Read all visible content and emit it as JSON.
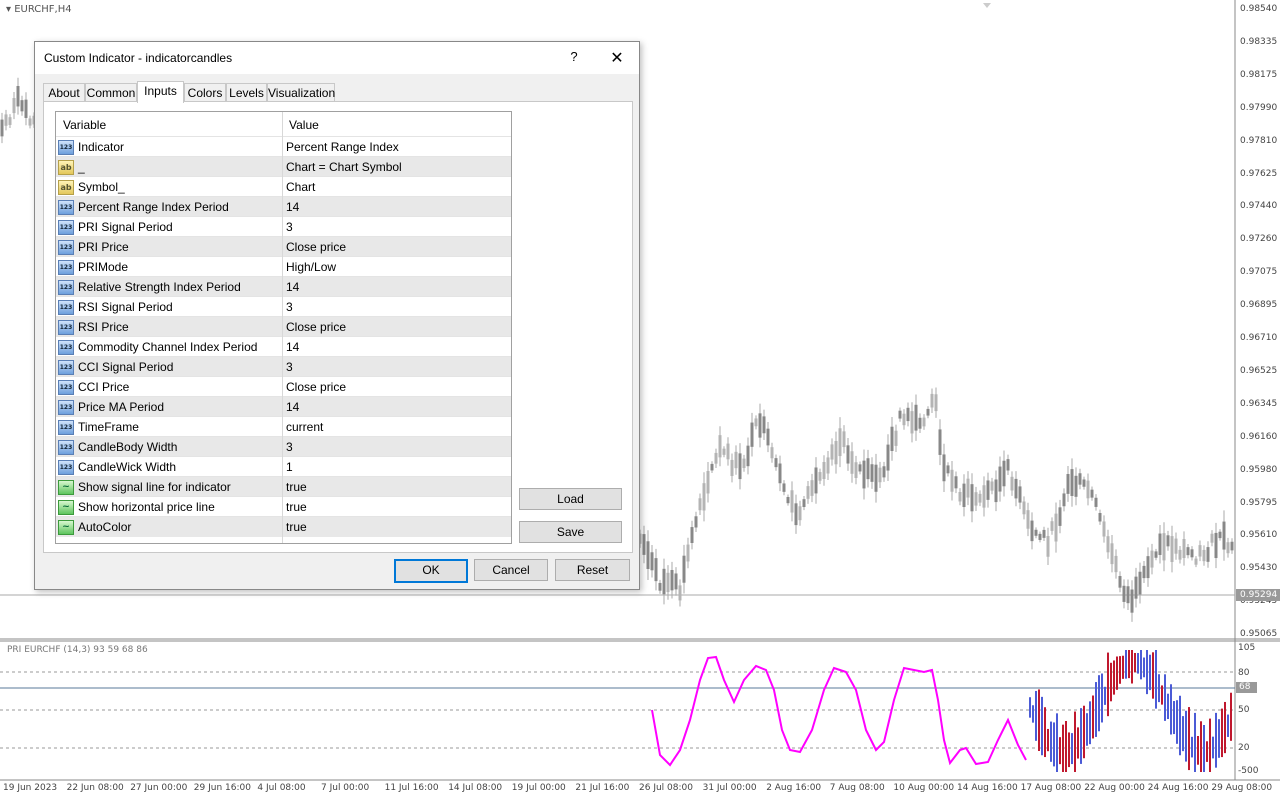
{
  "chart": {
    "symbol_label": "EURCHF,H4",
    "current_price": "0.95294",
    "price_axis": [
      "0.98540",
      "0.98335",
      "0.98175",
      "0.97990",
      "0.97810",
      "0.97625",
      "0.97440",
      "0.97260",
      "0.97075",
      "0.96895",
      "0.96710",
      "0.96525",
      "0.96345",
      "0.96160",
      "0.95980",
      "0.95795",
      "0.95610",
      "0.95430",
      "0.95245",
      "0.95065"
    ],
    "time_axis": [
      "19 Jun 2023",
      "22 Jun 08:00",
      "27 Jun 00:00",
      "29 Jun 16:00",
      "4 Jul 08:00",
      "7 Jul 00:00",
      "11 Jul 16:00",
      "14 Jul 08:00",
      "19 Jul 00:00",
      "21 Jul 16:00",
      "26 Jul 08:00",
      "31 Jul 00:00",
      "2 Aug 16:00",
      "7 Aug 08:00",
      "10 Aug 00:00",
      "14 Aug 16:00",
      "17 Aug 08:00",
      "22 Aug 00:00",
      "24 Aug 16:00",
      "29 Aug 08:00"
    ],
    "candle_color": "#b4b4b4"
  },
  "indicator": {
    "title": "PRI EURCHF (14,3) 93 59 68 86",
    "axis": [
      "105",
      "80",
      "50",
      "20",
      "-500"
    ],
    "current_value": "68",
    "line_color": "#ff00ff",
    "up_color": "#4b5bd6",
    "down_color": "#c0182e"
  },
  "dialog": {
    "title": "Custom Indicator - indicatorcandles",
    "help": "?",
    "close": "✕",
    "tabs": [
      "About",
      "Common",
      "Inputs",
      "Colors",
      "Levels",
      "Visualization"
    ],
    "active_tab": "Inputs",
    "columns": {
      "variable": "Variable",
      "value": "Value"
    },
    "rows": [
      {
        "icon": "123",
        "variable": "Indicator",
        "value": "Percent Range Index"
      },
      {
        "icon": "ab",
        "variable": "_",
        "value": "Chart = Chart Symbol"
      },
      {
        "icon": "ab",
        "variable": "Symbol_",
        "value": "Chart"
      },
      {
        "icon": "123",
        "variable": "Percent Range Index Period",
        "value": "14"
      },
      {
        "icon": "123",
        "variable": "PRI Signal Period",
        "value": "3"
      },
      {
        "icon": "123",
        "variable": "PRI Price",
        "value": "Close price"
      },
      {
        "icon": "123",
        "variable": "PRIMode",
        "value": "High/Low"
      },
      {
        "icon": "123",
        "variable": "Relative Strength Index Period",
        "value": "14"
      },
      {
        "icon": "123",
        "variable": "RSI Signal Period",
        "value": "3"
      },
      {
        "icon": "123",
        "variable": "RSI Price",
        "value": "Close price"
      },
      {
        "icon": "123",
        "variable": "Commodity Channel Index Period",
        "value": "14"
      },
      {
        "icon": "123",
        "variable": "CCI Signal Period",
        "value": "3"
      },
      {
        "icon": "123",
        "variable": "CCI Price",
        "value": "Close price"
      },
      {
        "icon": "123",
        "variable": "Price MA Period",
        "value": "14"
      },
      {
        "icon": "123",
        "variable": "TimeFrame",
        "value": "current"
      },
      {
        "icon": "123",
        "variable": "CandleBody Width",
        "value": "3"
      },
      {
        "icon": "123",
        "variable": "CandleWick Width",
        "value": "1"
      },
      {
        "icon": "bool",
        "variable": "Show signal line for indicator",
        "value": "true"
      },
      {
        "icon": "bool",
        "variable": "Show horizontal price line",
        "value": "true"
      },
      {
        "icon": "bool",
        "variable": "AutoColor",
        "value": "true"
      }
    ],
    "buttons": {
      "load": "Load",
      "save": "Save",
      "ok": "OK",
      "cancel": "Cancel",
      "reset": "Reset"
    }
  }
}
